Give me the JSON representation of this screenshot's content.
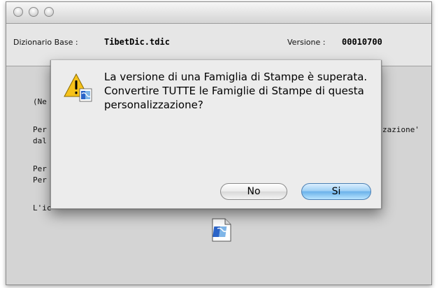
{
  "info": {
    "dict_label": "Dizionario Base :",
    "dict_value": "TibetDic.tdic",
    "version_label": "Versione :",
    "version_value": "00010700"
  },
  "content": {
    "line1": "(Ne",
    "line2": "Per",
    "line2_tail": "zazione'",
    "line3": "dal",
    "line4": "Per",
    "line5": "Per",
    "line6": "L'ic"
  },
  "dialog": {
    "message": "La versione di una Famiglia di Stampe è superata. Convertire TUTTE le Famiglie di Stampe di questa personalizzazione?",
    "no_label": "No",
    "si_label": "Si"
  },
  "colors": {
    "accent": "#6cb2ea",
    "window_bg": "#d6d6d6"
  },
  "icons": [
    "close-icon",
    "minimize-icon",
    "zoom-icon",
    "warning-icon",
    "app-badge-icon",
    "document-icon"
  ]
}
